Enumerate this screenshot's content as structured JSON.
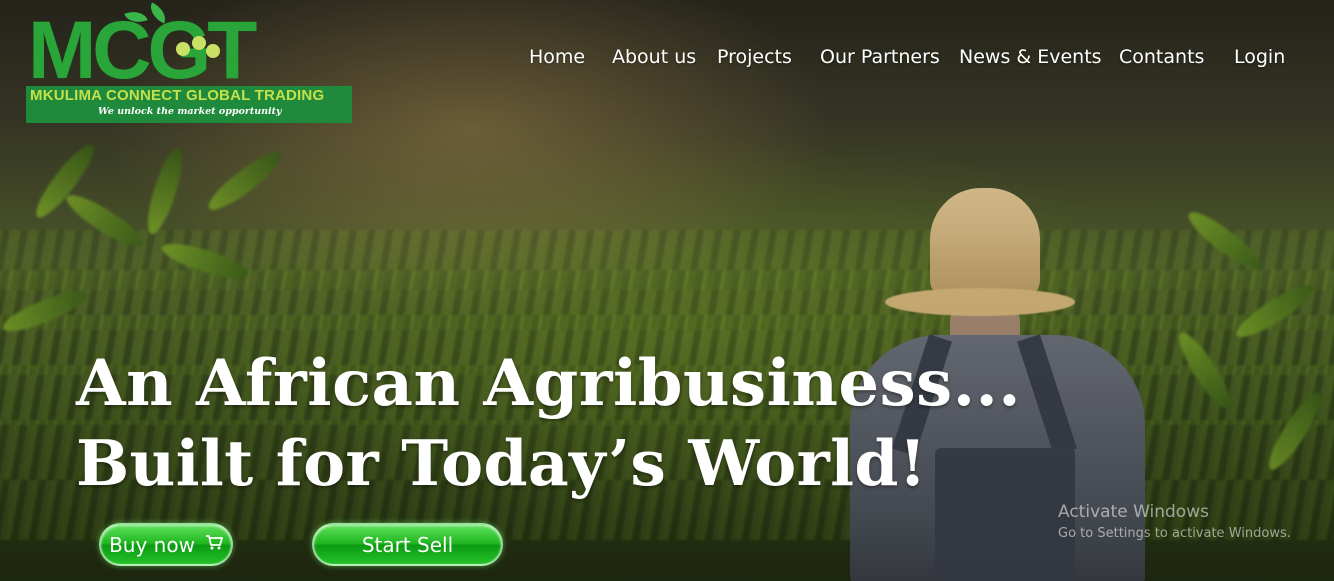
{
  "logo": {
    "mark": "MCGT",
    "name": "MKULIMA CONNECT GLOBAL TRADING",
    "slogan": "We unlock the market opportunity"
  },
  "nav": {
    "items": [
      {
        "label": "Home"
      },
      {
        "label": "About us"
      },
      {
        "label": "Projects"
      },
      {
        "label": "Our Partners"
      },
      {
        "label": "News & Events"
      },
      {
        "label": "Contants"
      },
      {
        "label": "Login"
      }
    ]
  },
  "hero": {
    "headline_line1": "An African Agribusiness...",
    "headline_line2": "Built for Today’s World!",
    "buy_label": "Buy now",
    "sell_label": "Start Sell"
  },
  "watermark": {
    "title": "Activate Windows",
    "subtitle": "Go to Settings to activate Windows."
  },
  "icons": {
    "cart": "shopping-cart-icon"
  },
  "colors": {
    "brand_green": "#2aa53a",
    "brand_band": "#1f8a3c",
    "brand_lime": "#c6e04a",
    "button_green": "#1fb51f"
  }
}
